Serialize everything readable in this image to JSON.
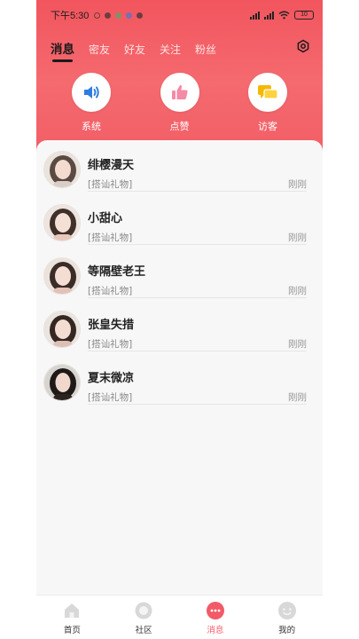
{
  "status_bar": {
    "time": "下午5:30",
    "battery": "10"
  },
  "tabs": [
    {
      "label": "消息",
      "active": true
    },
    {
      "label": "密友",
      "active": false
    },
    {
      "label": "好友",
      "active": false
    },
    {
      "label": "关注",
      "active": false
    },
    {
      "label": "粉丝",
      "active": false
    }
  ],
  "quick_actions": [
    {
      "label": "系统",
      "icon": "speaker-icon"
    },
    {
      "label": "点赞",
      "icon": "thumbs-up-icon"
    },
    {
      "label": "访客",
      "icon": "chat-bubbles-icon"
    }
  ],
  "messages": [
    {
      "name": "绯樱漫天",
      "preview": "[搭讪礼物]",
      "time": "刚刚"
    },
    {
      "name": "小甜心",
      "preview": "[搭讪礼物]",
      "time": "刚刚"
    },
    {
      "name": "等隔壁老王",
      "preview": "[搭讪礼物]",
      "time": "刚刚"
    },
    {
      "name": "张皇失措",
      "preview": "[搭讪礼物]",
      "time": "刚刚"
    },
    {
      "name": "夏末微凉",
      "preview": "[搭讪礼物]",
      "time": "刚刚"
    }
  ],
  "bottom_nav": [
    {
      "label": "首页",
      "icon": "home-icon",
      "active": false
    },
    {
      "label": "社区",
      "icon": "community-icon",
      "active": false
    },
    {
      "label": "消息",
      "icon": "message-icon",
      "active": true
    },
    {
      "label": "我的",
      "icon": "profile-icon",
      "active": false
    }
  ],
  "colors": {
    "accent": "#f25a67",
    "header_top": "#f2555e",
    "speaker_blue": "#2f7de0",
    "thumb_pink": "#f48aa5",
    "chat_yellow": "#f5b800"
  }
}
